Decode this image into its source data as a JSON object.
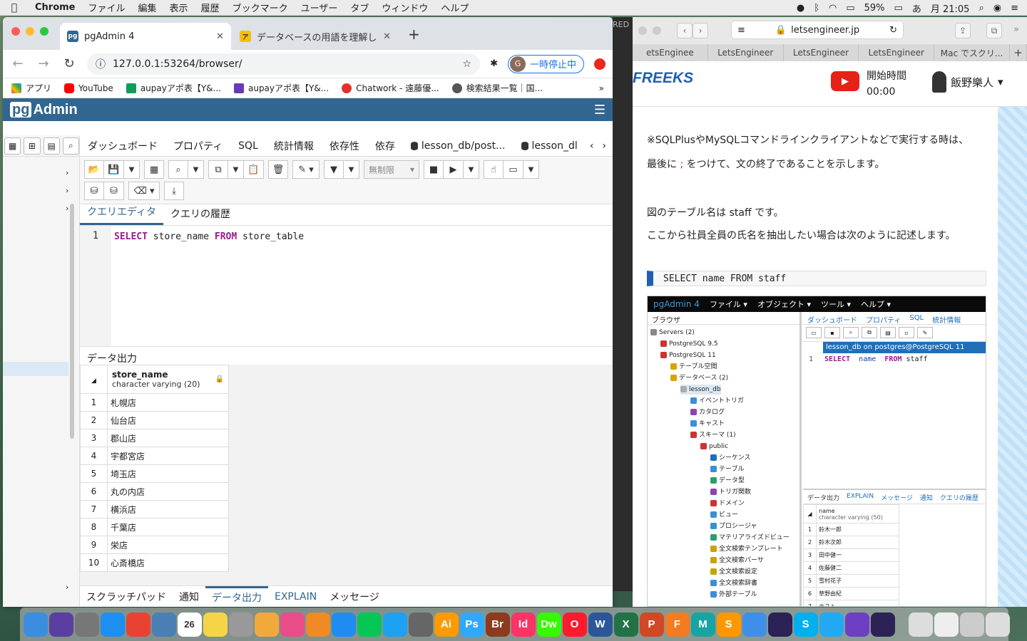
{
  "menubar": {
    "app": "Chrome",
    "items": [
      "ファイル",
      "編集",
      "表示",
      "履歴",
      "ブックマーク",
      "ユーザー",
      "タブ",
      "ウィンドウ",
      "ヘルプ"
    ],
    "battery": "59%",
    "kana": "あ",
    "clock": "月 21:05"
  },
  "chrome": {
    "tabs": [
      {
        "title": "pgAdmin 4",
        "favicon": "pg"
      },
      {
        "title": "データベースの用語を理解しよう",
        "favicon": "ア"
      }
    ],
    "url": "127.0.0.1:53264/browser/",
    "pause_label": "一時停止中",
    "avatar": "G",
    "bookmarks": [
      "アプリ",
      "YouTube",
      "aupayアポ表【Y&...",
      "aupayアポ表【Y&...",
      "Chatwork - 遠藤優...",
      "検索結果一覧｜国..."
    ]
  },
  "pgadmin": {
    "logo_pg": "pg",
    "logo_rest": "Admin",
    "tabs": [
      "ダッシュボード",
      "プロパティ",
      "SQL",
      "統計情報",
      "依存性",
      "依存",
      "lesson_db/post...",
      "lesson_dl"
    ],
    "limit_label": "無制限",
    "editor_tabs": [
      "クエリエディタ",
      "クエリの履歴"
    ],
    "line_number": "1",
    "sql": {
      "kw1": "SELECT",
      "col": " store_name ",
      "kw2": "FROM",
      "tbl": " store_table"
    },
    "output_title": "データ出力",
    "column": {
      "name": "store_name",
      "type": "character varying (20)"
    },
    "rows": [
      "札幌店",
      "仙台店",
      "郡山店",
      "宇都宮店",
      "埼玉店",
      "丸の内店",
      "横浜店",
      "千葉店",
      "栄店",
      "心斎橋店"
    ],
    "bottom_tabs": [
      "スクラッチパッド",
      "通知",
      "データ出力",
      "EXPLAIN",
      "メッセージ"
    ]
  },
  "strip_label": "RED",
  "safari": {
    "url": "letsengineer.jp",
    "tabs": [
      "etsEnginee",
      "LetsEngineer",
      "LetsEngineer",
      "LetsEngineer",
      "Mac でスクリ..."
    ],
    "logo": "FREEKS",
    "start_label": "開始時間",
    "start_time": "00:00",
    "user": "飯野樂人",
    "p1": "※SQLPlusやMySQLコマンドラインクライアントなどで実行する時は、",
    "p2a": "最後に ",
    "p2semi": ";",
    "p2b": " をつけて、文の終了であることを示します。",
    "p3": "図のテーブル名は staff です。",
    "p4": "ここから社員全員の氏名を抽出したい場合は次のように記述します。",
    "code": "SELECT name FROM staff"
  },
  "shot": {
    "brand": "pgAdmin 4",
    "menus": [
      "ファイル ▾",
      "オブジェクト ▾",
      "ツール ▾",
      "ヘルプ ▾"
    ],
    "browser": "ブラウザ",
    "tree": [
      "Servers (2)",
      "PostgreSQL 9.5",
      "PostgreSQL 11",
      "テーブル空間",
      "データベース (2)",
      "lesson_db",
      "イベントトリガ",
      "カタログ",
      "キャスト",
      "スキーマ (1)",
      "public",
      "シーケンス",
      "テーブル",
      "データ型",
      "トリガ関数",
      "ドメイン",
      "ビュー",
      "プロシージャ",
      "マテリアライズドビュー",
      "全文検索テンプレート",
      "全文検索パーサ",
      "全文検索設定",
      "全文検索辞書",
      "外部テーブル"
    ],
    "tabs": [
      "ダッシュボード",
      "プロパティ",
      "SQL",
      "統計情報"
    ],
    "query_title": "lesson_db on postgres@PostgreSQL 11",
    "sql": {
      "kw1": "SELECT",
      "col": "name",
      "kw2": "FROM",
      "tbl": "staff"
    },
    "out_tabs": [
      "データ出力",
      "EXPLAIN",
      "メッセージ",
      "通知",
      "クエリの履歴"
    ],
    "col_name": "name",
    "col_type": "character varying (50)",
    "rows": [
      "鈴木一郎",
      "鈴木次郎",
      "田中健一",
      "佐藤健二",
      "雪村花子",
      "草野由紀",
      "テスト"
    ]
  },
  "dock": {
    "calendar_day": "26"
  }
}
